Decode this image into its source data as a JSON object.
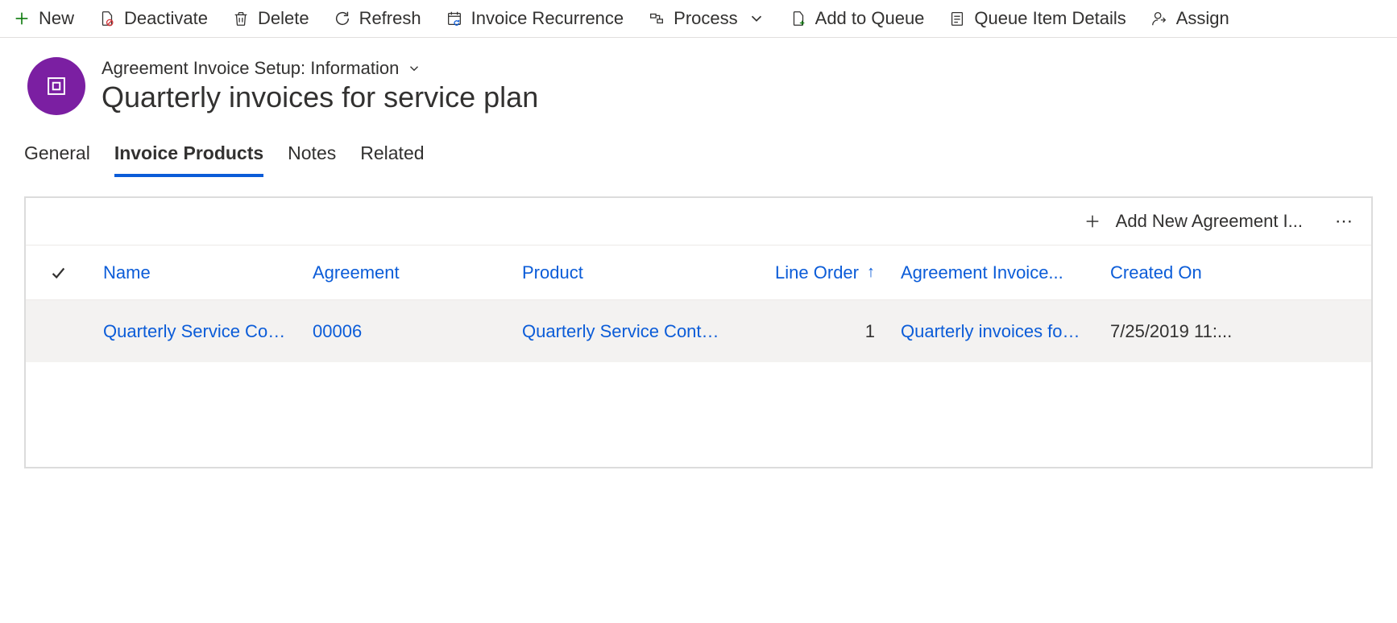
{
  "commandBar": {
    "new": "New",
    "deactivate": "Deactivate",
    "delete": "Delete",
    "refresh": "Refresh",
    "invoiceRecurrence": "Invoice Recurrence",
    "process": "Process",
    "addToQueue": "Add to Queue",
    "queueItemDetails": "Queue Item Details",
    "assign": "Assign"
  },
  "header": {
    "breadcrumb": "Agreement Invoice Setup: Information",
    "title": "Quarterly invoices for service plan"
  },
  "tabs": {
    "general": "General",
    "invoiceProducts": "Invoice Products",
    "notes": "Notes",
    "related": "Related"
  },
  "gridToolbar": {
    "addNew": "Add New Agreement I..."
  },
  "columns": {
    "name": "Name",
    "agreement": "Agreement",
    "product": "Product",
    "lineOrder": "Line Order",
    "agreementInvoice": "Agreement Invoice...",
    "createdOn": "Created On"
  },
  "rows": [
    {
      "name": "Quarterly Service Contract.",
      "agreement": "00006",
      "product": "Quarterly Service Contract.",
      "lineOrder": "1",
      "agreementInvoice": "Quarterly invoices for servi",
      "createdOn": "7/25/2019 11:..."
    }
  ]
}
